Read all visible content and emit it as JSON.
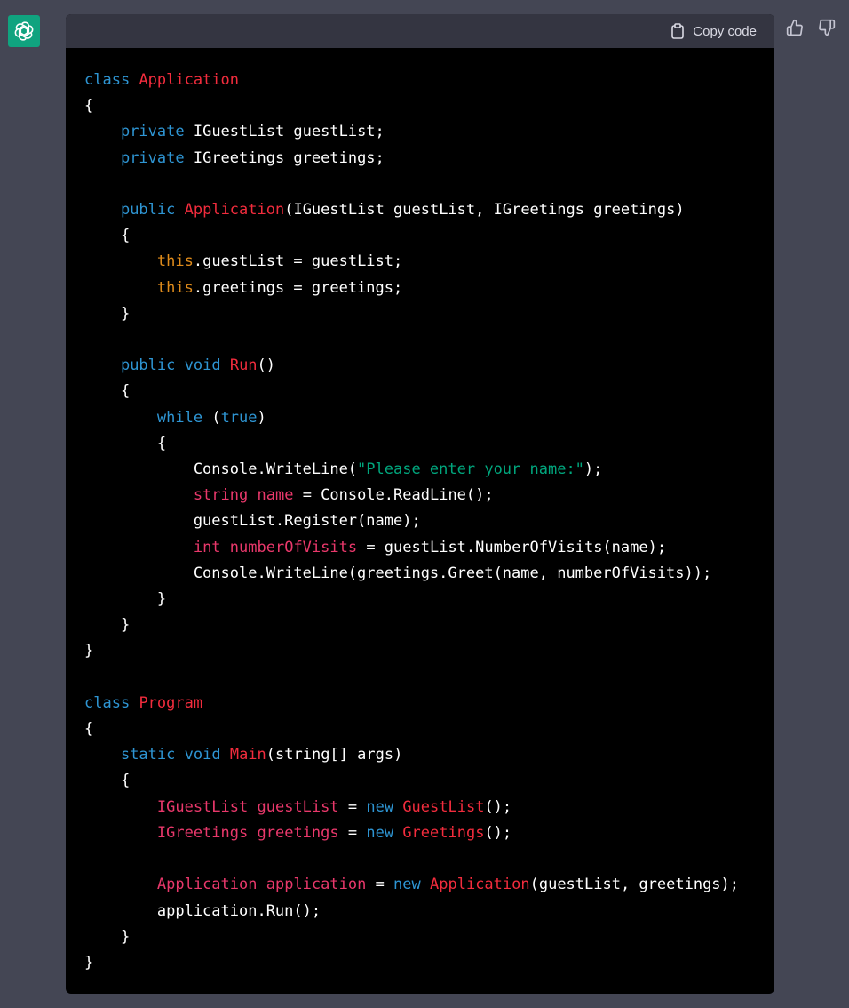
{
  "assistant": {
    "avatar_icon": "openai-logo-icon",
    "avatar_color": "#10a37f"
  },
  "code_block": {
    "copy_label": "Copy code",
    "copy_icon": "clipboard-icon",
    "language": "csharp",
    "lines": [
      [
        {
          "t": "class",
          "c": "kw"
        },
        {
          "t": " "
        },
        {
          "t": "Application",
          "c": "ty"
        }
      ],
      [
        {
          "t": "{"
        }
      ],
      [
        {
          "t": "    "
        },
        {
          "t": "private",
          "c": "kw"
        },
        {
          "t": " IGuestList guestList;"
        }
      ],
      [
        {
          "t": "    "
        },
        {
          "t": "private",
          "c": "kw"
        },
        {
          "t": " IGreetings greetings;"
        }
      ],
      [],
      [
        {
          "t": "    "
        },
        {
          "t": "public",
          "c": "kw"
        },
        {
          "t": " "
        },
        {
          "t": "Application",
          "c": "ty"
        },
        {
          "t": "(IGuestList guestList, IGreetings greetings)"
        }
      ],
      [
        {
          "t": "    {"
        }
      ],
      [
        {
          "t": "        "
        },
        {
          "t": "this",
          "c": "th"
        },
        {
          "t": ".guestList = guestList;"
        }
      ],
      [
        {
          "t": "        "
        },
        {
          "t": "this",
          "c": "th"
        },
        {
          "t": ".greetings = greetings;"
        }
      ],
      [
        {
          "t": "    }"
        }
      ],
      [],
      [
        {
          "t": "    "
        },
        {
          "t": "public",
          "c": "kw"
        },
        {
          "t": " "
        },
        {
          "t": "void",
          "c": "kw"
        },
        {
          "t": " "
        },
        {
          "t": "Run",
          "c": "ty"
        },
        {
          "t": "()"
        }
      ],
      [
        {
          "t": "    {"
        }
      ],
      [
        {
          "t": "        "
        },
        {
          "t": "while",
          "c": "kw"
        },
        {
          "t": " ("
        },
        {
          "t": "true",
          "c": "kw"
        },
        {
          "t": ")"
        }
      ],
      [
        {
          "t": "        {"
        }
      ],
      [
        {
          "t": "            Console.WriteLine("
        },
        {
          "t": "\"Please enter your name:\"",
          "c": "st"
        },
        {
          "t": ");"
        }
      ],
      [
        {
          "t": "            "
        },
        {
          "t": "string",
          "c": "va"
        },
        {
          "t": " "
        },
        {
          "t": "name",
          "c": "va"
        },
        {
          "t": " = Console.ReadLine();"
        }
      ],
      [
        {
          "t": "            guestList.Register(name);"
        }
      ],
      [
        {
          "t": "            "
        },
        {
          "t": "int",
          "c": "va"
        },
        {
          "t": " "
        },
        {
          "t": "numberOfVisits",
          "c": "va"
        },
        {
          "t": " = guestList.NumberOfVisits(name);"
        }
      ],
      [
        {
          "t": "            Console.WriteLine(greetings.Greet(name, numberOfVisits));"
        }
      ],
      [
        {
          "t": "        }"
        }
      ],
      [
        {
          "t": "    }"
        }
      ],
      [
        {
          "t": "}"
        }
      ],
      [],
      [
        {
          "t": "class",
          "c": "kw"
        },
        {
          "t": " "
        },
        {
          "t": "Program",
          "c": "ty"
        }
      ],
      [
        {
          "t": "{"
        }
      ],
      [
        {
          "t": "    "
        },
        {
          "t": "static",
          "c": "kw"
        },
        {
          "t": " "
        },
        {
          "t": "void",
          "c": "kw"
        },
        {
          "t": " "
        },
        {
          "t": "Main",
          "c": "ty"
        },
        {
          "t": "(string[] args)"
        }
      ],
      [
        {
          "t": "    {"
        }
      ],
      [
        {
          "t": "        "
        },
        {
          "t": "IGuestList",
          "c": "va"
        },
        {
          "t": " "
        },
        {
          "t": "guestList",
          "c": "va"
        },
        {
          "t": " = "
        },
        {
          "t": "new",
          "c": "kw"
        },
        {
          "t": " "
        },
        {
          "t": "GuestList",
          "c": "ty"
        },
        {
          "t": "();"
        }
      ],
      [
        {
          "t": "        "
        },
        {
          "t": "IGreetings",
          "c": "va"
        },
        {
          "t": " "
        },
        {
          "t": "greetings",
          "c": "va"
        },
        {
          "t": " = "
        },
        {
          "t": "new",
          "c": "kw"
        },
        {
          "t": " "
        },
        {
          "t": "Greetings",
          "c": "ty"
        },
        {
          "t": "();"
        }
      ],
      [],
      [
        {
          "t": "        "
        },
        {
          "t": "Application",
          "c": "va"
        },
        {
          "t": " "
        },
        {
          "t": "application",
          "c": "va"
        },
        {
          "t": " = "
        },
        {
          "t": "new",
          "c": "kw"
        },
        {
          "t": " "
        },
        {
          "t": "Application",
          "c": "ty"
        },
        {
          "t": "(guestList, greetings);"
        }
      ],
      [
        {
          "t": "        application.Run();"
        }
      ],
      [
        {
          "t": "    }"
        }
      ],
      [
        {
          "t": "}"
        }
      ]
    ]
  },
  "feedback": {
    "thumbs_up_icon": "thumbs-up-icon",
    "thumbs_down_icon": "thumbs-down-icon"
  }
}
